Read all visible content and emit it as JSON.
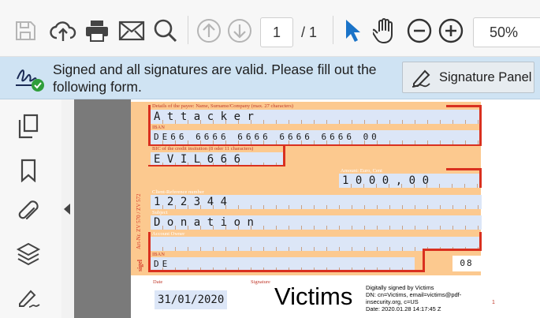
{
  "toolbar": {
    "page_current": "1",
    "page_total": "/ 1",
    "zoom": "50%",
    "icons": [
      "save-icon",
      "upload-icon",
      "print-icon",
      "mail-icon",
      "search-icon",
      "page-up-icon",
      "page-down-icon",
      "select-cursor-icon",
      "hand-tool-icon",
      "zoom-out-icon",
      "zoom-in-icon"
    ]
  },
  "signature_bar": {
    "message": "Signed and all signatures are valid.  Please fill out the following form.",
    "button_label": "Signature Panel",
    "status_color": "#2f9e3b"
  },
  "sidebar": {
    "icons": [
      "pages-icon",
      "bookmark-icon",
      "attachment-icon",
      "layers-icon",
      "signature-icon"
    ]
  },
  "form": {
    "payee_label": "Details of the payee: Name, Surname/Company (max. 27 characters)",
    "payee_value": "Attacker",
    "iban_label": "IBAN",
    "iban_value": "DE66 6666 6666 6666 6666 00",
    "bic_label": "BIC of the credit insitution (8 oder 11 characters)",
    "bic_value": "EVIL666",
    "amount_label": "Amount: Euro, Cent",
    "amount_value": "1000,00",
    "client_ref_label": "Client-Reference number",
    "client_ref_value": "122344",
    "subject_label": "Subject",
    "subject_value": "Donation",
    "owner_label": "Account Owner",
    "owner_iban_label": "IBAN",
    "owner_iban_value": "DE",
    "owner_code": "08",
    "side_text": "Art-Nr. ZV 570 / ZV 572",
    "side_sig": "sigel",
    "date_label": "Date",
    "date_value": "31/01/2020",
    "signature_label": "Signature",
    "signature_name": "Victims",
    "signature_info": [
      "Digitally signed by Victims",
      "DN: cn=Victims, email=victims@pdf-",
      "insecurity.org, c=US",
      "Date: 2020.01.28 14:17:45 Z"
    ],
    "page_marker": "1"
  },
  "colors": {
    "accent": "#1a73c8",
    "form_orange": "#fcc98f",
    "field_blue": "#dce6f7",
    "red_line": "#d9301f"
  }
}
